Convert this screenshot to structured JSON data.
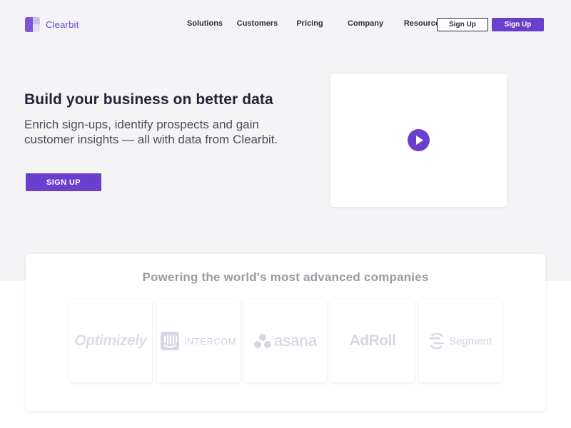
{
  "brand": {
    "name": "Clearbit",
    "accent": "#6a3fcd"
  },
  "nav": {
    "items": [
      "Solutions",
      "Customers",
      "Pricing",
      "Company",
      "Resources"
    ],
    "signup_outline": "Sign Up",
    "signup_solid": "Sign Up"
  },
  "hero": {
    "title": "Build your business on better data",
    "subtitle": "Enrich sign-ups, identify prospects and gain customer insights — all with data from Clearbit.",
    "cta": "SIGN UP",
    "video_icon": "play-icon"
  },
  "logos": {
    "heading": "Powering the world's most advanced companies",
    "companies": [
      "Optimizely",
      "INTERCOM",
      "asana",
      "AdRoll",
      "Segment"
    ]
  }
}
